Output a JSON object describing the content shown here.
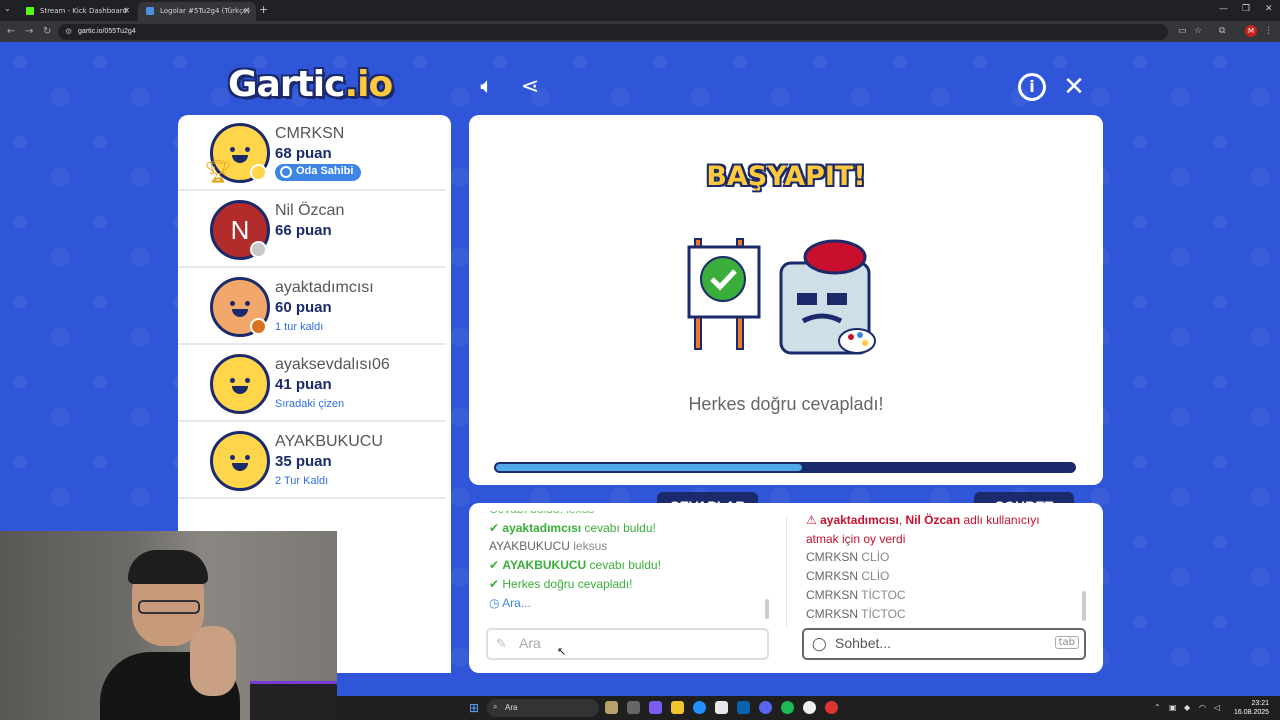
{
  "browser": {
    "tabs": [
      {
        "label": "Stream - Kick Dashboard",
        "favicon_color": "#53fc18",
        "icon": "kick-favicon-icon"
      },
      {
        "label": "Logolar #5Tu2g4 (Türkçe)",
        "favicon_color": "#4a90e2",
        "icon": "gartic-favicon-icon"
      }
    ],
    "url": "gartic.io/055Tu2g4",
    "profile_initial": "M"
  },
  "game": {
    "logo_main": "Gartic",
    "logo_suffix": ".io",
    "players": [
      {
        "name": "CMRKSN",
        "points": "68 puan",
        "badge": "Oda Sahibi",
        "status_color": "#ffd54a",
        "avatar": "smiley",
        "trophy": "1"
      },
      {
        "name": "Nil Özcan",
        "points": "66 puan",
        "status_color": "#c9c9c9",
        "avatar": "letter",
        "letter": "N"
      },
      {
        "name": "ayaktadımcısı",
        "points": "60 puan",
        "note": "1 tur kaldı",
        "status_color": "#d9731f",
        "avatar": "girl"
      },
      {
        "name": "ayaksevdalısı06",
        "points": "41 puan",
        "note": "Sıradaki çizen",
        "avatar": "smiley"
      },
      {
        "name": "AYAKBUKUCU",
        "points": "35 puan",
        "note": "2 Tur Kaldı",
        "avatar": "smiley"
      }
    ],
    "main": {
      "title": "BAŞYAPIT!",
      "result": "Herkes doğru cevapladı!",
      "progress": 0.53
    },
    "answers_tab": "CEVAPLAR",
    "chat_tab": "SOHBET",
    "answers": [
      {
        "parts": [
          {
            "t": "Cevabı buldu! lexus",
            "c": "green"
          }
        ],
        "partial": true
      },
      {
        "parts": [
          {
            "t": "✔ ",
            "c": "green"
          },
          {
            "t": "ayaktadımcısı",
            "c": "green b"
          },
          {
            "t": " cevabı buldu!",
            "c": "green"
          }
        ]
      },
      {
        "parts": [
          {
            "t": "AYAKBUKUCU",
            "c": "mname"
          },
          {
            "t": " leksus",
            "c": "gray"
          }
        ]
      },
      {
        "parts": [
          {
            "t": "✔ ",
            "c": "green"
          },
          {
            "t": "AYAKBUKUCU",
            "c": "green b"
          },
          {
            "t": " cevabı buldu!",
            "c": "green"
          }
        ]
      },
      {
        "parts": [
          {
            "t": "✔ ",
            "c": "green"
          },
          {
            "t": "Herkes doğru cevapladı!",
            "c": "green"
          }
        ]
      },
      {
        "parts": [
          {
            "t": "◷ ",
            "c": "blue"
          },
          {
            "t": "Ara...",
            "c": "blue"
          }
        ]
      }
    ],
    "chat": [
      {
        "parts": [
          {
            "t": "⚠ ",
            "c": "red"
          },
          {
            "t": "ayaktadımcısı",
            "c": "red b"
          },
          {
            "t": ", ",
            "c": "red"
          },
          {
            "t": "Nil Özcan",
            "c": "red b"
          },
          {
            "t": " adlı kullanıcıyı",
            "c": "red"
          }
        ]
      },
      {
        "parts": [
          {
            "t": "atmak için oy verdi",
            "c": "red"
          }
        ]
      },
      {
        "parts": [
          {
            "t": "CMRKSN",
            "c": "mname"
          },
          {
            "t": " CLİO",
            "c": "gray"
          }
        ]
      },
      {
        "parts": [
          {
            "t": "CMRKSN",
            "c": "mname"
          },
          {
            "t": " CLİO",
            "c": "gray"
          }
        ]
      },
      {
        "parts": [
          {
            "t": "CMRKSN",
            "c": "mname"
          },
          {
            "t": " TİCTOC",
            "c": "gray"
          }
        ]
      },
      {
        "parts": [
          {
            "t": "CMRKSN",
            "c": "mname"
          },
          {
            "t": " TİCTOC",
            "c": "gray"
          }
        ]
      }
    ],
    "answer_input": {
      "placeholder": "Ara"
    },
    "chat_input": {
      "placeholder": "Sohbet...",
      "hint": "tab"
    }
  },
  "taskbar": {
    "search_label": "Ara",
    "time": "23:21",
    "date": "16.08.2025"
  }
}
